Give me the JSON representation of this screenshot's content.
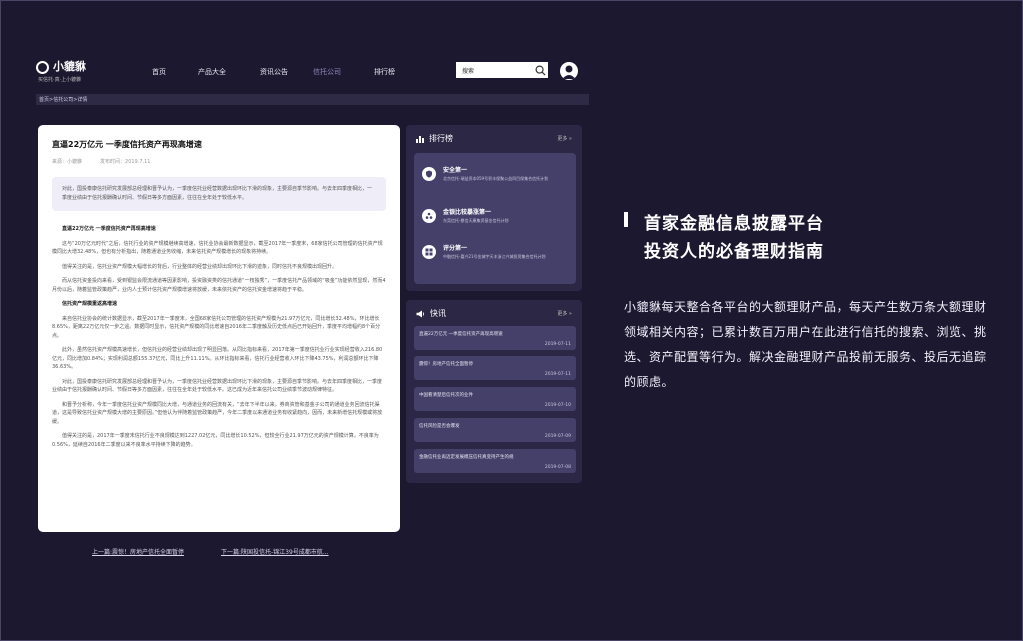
{
  "brand": {
    "name": "小貔貅",
    "tagline": "买信托·真·上小貔貅"
  },
  "nav": {
    "items": [
      {
        "label": "首页",
        "active": false
      },
      {
        "label": "产品大全",
        "active": false
      },
      {
        "label": "资讯公告",
        "active": false
      },
      {
        "label": "信托公司",
        "active": true
      },
      {
        "label": "排行榜",
        "active": false
      }
    ],
    "search_placeholder": "搜索"
  },
  "breadcrumb": "首页>信托公司>详情",
  "article": {
    "title": "直逼22万亿元 一季度信托资产再现高增速",
    "source": "来源：小貔貅",
    "date": "发布时间：2019.7.11",
    "summary": "对此，国投泰康信托研究发展部总经理和晋予认为，一季度信托业经营数据出现环比下滑的现象，主要源自季节影响。与去年四季度相比，一季度业绩由于信托报酬确认时间、节假日等多方面因素，往往在全年处于较低水平。",
    "sections": [
      {
        "heading": "直逼22万亿元 一季度信托资产再现高增速",
        "paragraphs": [
          "这与“20万亿元时代”之后，信托行业的资产规模继续高增速，信托业协会最新数据显示，截至2017年一季度末，68家信托公司管理的信托资产规模同比大增32.48%，但也有分析指出，随着通道业务收缩，未来信托资产规模增长的现象将持续。",
          "值得关注的是，信托业资产规模大幅增长的背后，行业整体的经营业绩却出现环比下滑的迹象，同时信托不良规模出现回升。",
          "而从信托资金投向来看，受到银监会限流通道等因素影响，投资融资类的信托通道“一枝独秀”，一季度信托产品领域的“吸金”功能依然显现，然而4月份以后，随着监管政策趋严，业内人士预计信托资产规模增速将放缓，未来依托资产的信托资金增速将趋于平稳。"
        ]
      },
      {
        "heading": "信托资产规模重返高增速",
        "paragraphs": [
          "来自信托业协会的统计数据显示，截至2017年一季度末，全国68家信托公司管理的信托资产规模为21.97万亿元，同比增长32.48%，环比增长8.65%，距离22万亿元仅一步之遥。数据同时显示，信托资产规模的同比增速自2016年二季度触及历史低点后已开始回升，季度平均增幅约8个百分点。",
          "此外，虽然信托资产规模高速增长，但信托业的经营业绩却出现了明显回落。从同比指标来看，2017年第一季度信托业行业实现经营收入216.80亿元，同比增加0.84%；实现利润总额155.37亿元，同比上升11.11%。从环比指标来看，信托行业经营收入环比下降43.75%，利润总额环比下降36.63%。",
          "对此，国投泰康信托研究发展部总经理和晋予认为，一季度信托业经营数据出现环比下滑的现象，主要源自季节影响。与去年四季度相比，一季度业绩由于信托报酬确认时间、节假日等多方面因素，往往在全年处于较低水平。这已成为近年来信托公司业绩季节波动规律特征。",
          "和晋予分析称，今年一季度信托业资产规模同比大增，与通道业务的回流有关，“去年下半年以来，券商资管和基金子公司的通道业务回流信托渠道，这是导致信托业资产规模大增的主要原因。”但他认为伴随着监管政策趋严，今年二季度以来通道业务有收紧趋向，因而，未来新增信托规模或将放缓。",
          "值得关注的是，2017年一季度末信托行业不良规模达到1227.02亿元，同比增长10.52%，但较全行业21.97万亿元的资产规模计算，不良率为0.56%，延续自2016年二季度以来不良率水平持续下降的趋势。"
        ]
      }
    ],
    "prev": "上一篇:震惊！房地产信托全面暂停",
    "next": "下一篇:陕国投信托-锦江39号成都市航..."
  },
  "ranking": {
    "title": "排行榜",
    "more": "更多 »",
    "items": [
      {
        "name": "安全第一",
        "desc": "北京信托-瑞益资本059号积丰保聚公益同目保集合信托计划",
        "icon": "shield-icon"
      },
      {
        "name": "金银比较暴涨第一",
        "desc": "东莞信托-鼎信天康集资基金信托计划",
        "icon": "group-icon"
      },
      {
        "name": "评分第一",
        "desc": "中融信托-嘉兴21号金城宇天丰浙江兴城投资集合信托计划",
        "icon": "grid-icon"
      }
    ]
  },
  "news": {
    "title": "快讯",
    "more": "更多 »",
    "items": [
      {
        "title": "直逼22万亿元 一季度信托资产再现高增速",
        "date": "2019-07-11"
      },
      {
        "title": "震惊！房地产信托全面暂停",
        "date": "2019-07-11"
      },
      {
        "title": "中国看清楚后信托次的业件",
        "date": "2019-07-10"
      },
      {
        "title": "信托风险是否会爆发",
        "date": "2019-07-09"
      },
      {
        "title": "金融信托业再迈定发展模压信托真变持产生的规",
        "date": "2019-07-08"
      }
    ]
  },
  "promo": {
    "heading1": "首家金融信息披露平台",
    "heading2": "投资人的必备理财指南",
    "body": "小貔貅每天整合各平台的大额理财产品，每天产生数万条大额理财领域相关内容；已累计数百万用户在此进行信托的搜索、浏览、挑选、资产配置等行为。解决金融理财产品投前无服务、投后无追踪的顾虑。"
  },
  "colors": {
    "background": "#1c1830",
    "panel": "#2b2744",
    "card": "#44406a",
    "active_nav": "#8d88b8"
  }
}
